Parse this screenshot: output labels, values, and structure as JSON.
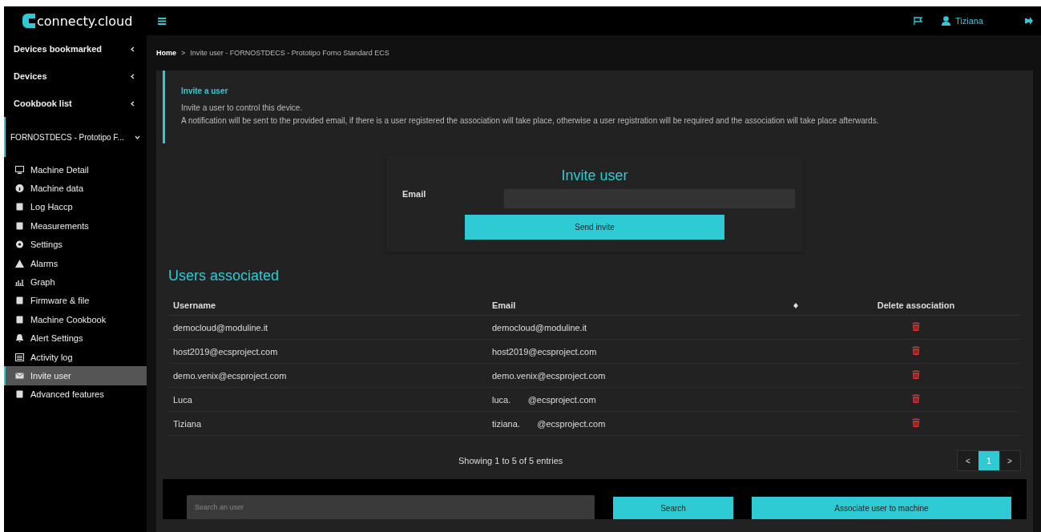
{
  "brand": {
    "name": "connecty.cloud"
  },
  "topbar": {
    "user": "Tiziana"
  },
  "sidebar": {
    "groups": [
      {
        "label": "Devices bookmarked",
        "expanded": false
      },
      {
        "label": "Devices",
        "expanded": false
      },
      {
        "label": "Cookbook list",
        "expanded": false
      },
      {
        "label": "FORNOSTDECS - Prototipo F...",
        "expanded": true
      }
    ],
    "items": [
      {
        "label": "Machine Detail",
        "selected": false
      },
      {
        "label": "Machine data",
        "selected": false
      },
      {
        "label": "Log Haccp",
        "selected": false
      },
      {
        "label": "Measurements",
        "selected": false
      },
      {
        "label": "Settings",
        "selected": false
      },
      {
        "label": "Alarms",
        "selected": false
      },
      {
        "label": "Graph",
        "selected": false
      },
      {
        "label": "Firmware & file",
        "selected": false
      },
      {
        "label": "Machine Cookbook",
        "selected": false
      },
      {
        "label": "Alert Settings",
        "selected": false
      },
      {
        "label": "Activity log",
        "selected": false
      },
      {
        "label": "Invite user",
        "selected": true
      },
      {
        "label": "Advanced features",
        "selected": false
      }
    ]
  },
  "breadcrumb": [
    "Home",
    ">",
    "Invite user - FORNOSTDECS - Prototipo Forno Standard ECS"
  ],
  "callout": {
    "title": "Invite a user",
    "lines": [
      "Invite a user to control this device.",
      "A notification will be sent to the provided email, if there is a user registered the association will take place, otherwise a user registration will be required and the association will take place afterwards."
    ]
  },
  "invite_form": {
    "title": "Invite user",
    "email_label": "Email",
    "button": "Send invite"
  },
  "users": {
    "title": "Users associated",
    "columns": [
      "Username",
      "Email",
      "Delete association"
    ],
    "rows": [
      {
        "username": "democloud@moduline.it",
        "email": "democloud@moduline.it"
      },
      {
        "username": "host2019@ecsproject.com",
        "email": "host2019@ecsproject.com"
      },
      {
        "username": "demo.venix@ecsproject.com",
        "email": "demo.venix@ecsproject.com"
      },
      {
        "username": "Luca",
        "email": "luca.       @ecsproject.com"
      },
      {
        "username": "Tiziana",
        "email": "tiziana.       @ecsproject.com"
      }
    ],
    "info": "Showing 1 to 5 of 5 entries",
    "pagination": {
      "prev": "<",
      "pages": [
        {
          "label": "1",
          "selected": true
        }
      ],
      "next": ">"
    }
  },
  "associate": {
    "placeholder": "Search an user",
    "search_button": "Search",
    "associate_button": "Associate user to machine"
  }
}
